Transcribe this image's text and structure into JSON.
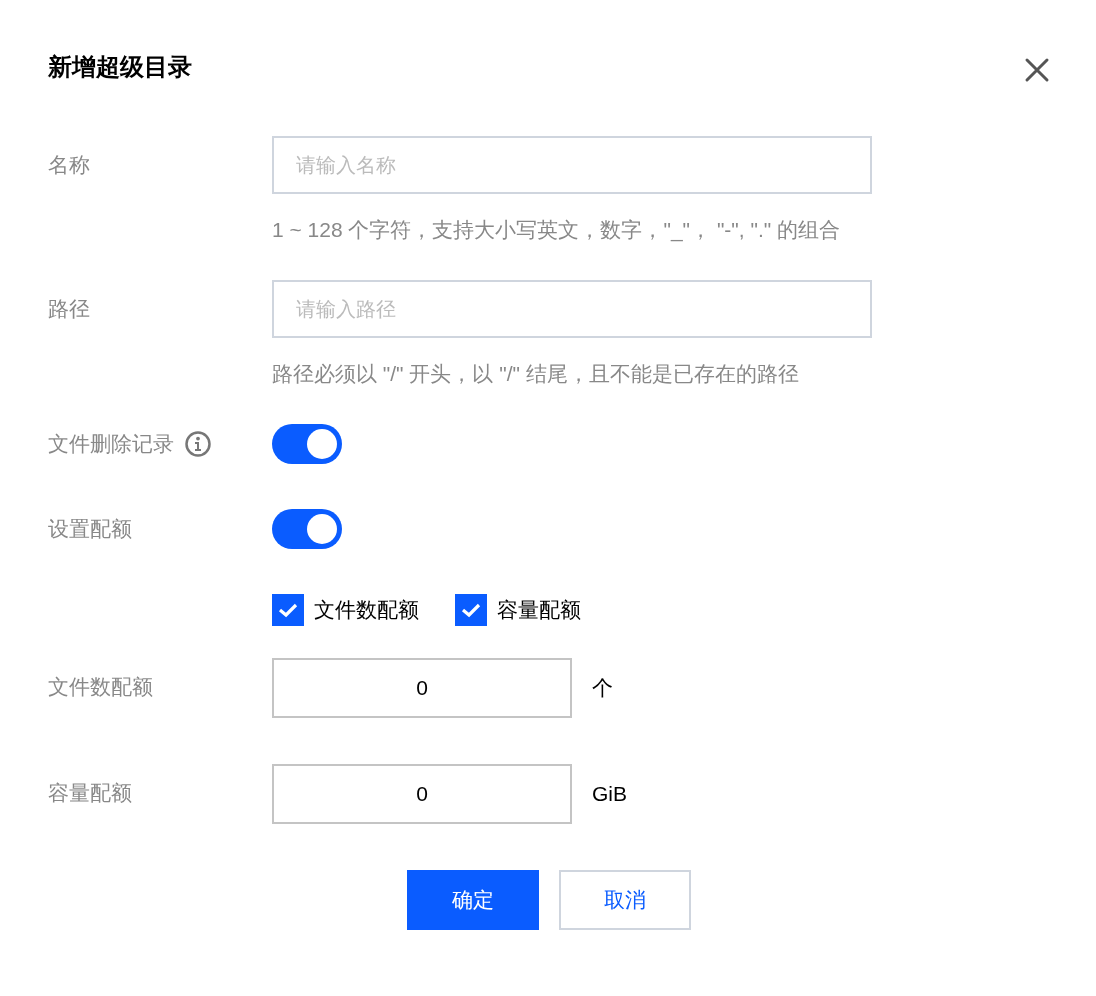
{
  "dialog": {
    "title": "新增超级目录"
  },
  "rows": [
    {
      "kind": "text",
      "label": "名称",
      "placeholder": "请输入名称",
      "hint": "1 ~ 128 个字符，支持大小写英文，数字，\"_\"， \"-\", \".\" 的组合"
    },
    {
      "kind": "text",
      "label": "路径",
      "placeholder": "请输入路径",
      "hint": "路径必须以 \"/\" 开头，以 \"/\" 结尾，且不能是已存在的路径"
    },
    {
      "kind": "switch",
      "label": "文件删除记录",
      "info": true,
      "on": true
    },
    {
      "kind": "switch",
      "label": "设置配额",
      "on": true
    },
    {
      "kind": "checks",
      "options": [
        {
          "label": "文件数配额",
          "checked": true
        },
        {
          "label": "容量配额",
          "checked": true
        }
      ]
    },
    {
      "kind": "number",
      "label": "文件数配额",
      "value": "0",
      "unit": "个"
    },
    {
      "kind": "number",
      "label": "容量配额",
      "value": "0",
      "unit": "GiB"
    }
  ],
  "buttons": [
    {
      "label": "确定",
      "kind": "primary"
    },
    {
      "label": "取消",
      "kind": "secondary"
    }
  ]
}
